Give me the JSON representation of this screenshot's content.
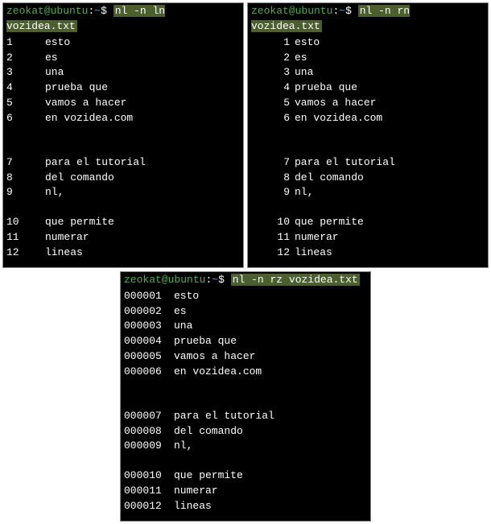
{
  "prompt": {
    "user": "zeokat",
    "host": "ubuntu",
    "path": "~",
    "symbol": "$"
  },
  "terminals": {
    "ln": {
      "command": "nl -n ln vozidea.txt",
      "lines": [
        {
          "n": "1",
          "t": "esto"
        },
        {
          "n": "2",
          "t": "es"
        },
        {
          "n": "3",
          "t": "una"
        },
        {
          "n": "4",
          "t": "prueba que"
        },
        {
          "n": "5",
          "t": "vamos a hacer"
        },
        {
          "n": "6",
          "t": "en vozidea.com"
        },
        {
          "blank": true
        },
        {
          "blank": true
        },
        {
          "n": "7",
          "t": "para el tutorial"
        },
        {
          "n": "8",
          "t": "del comando"
        },
        {
          "n": "9",
          "t": "nl,"
        },
        {
          "blank": true
        },
        {
          "n": "10",
          "t": "que permite"
        },
        {
          "n": "11",
          "t": "numerar"
        },
        {
          "n": "12",
          "t": "lineas"
        }
      ]
    },
    "rn": {
      "command": "nl -n rn vozidea.txt",
      "lines": [
        {
          "n": "1",
          "t": "esto"
        },
        {
          "n": "2",
          "t": "es"
        },
        {
          "n": "3",
          "t": "una"
        },
        {
          "n": "4",
          "t": "prueba que"
        },
        {
          "n": "5",
          "t": "vamos a hacer"
        },
        {
          "n": "6",
          "t": "en vozidea.com"
        },
        {
          "blank": true
        },
        {
          "blank": true
        },
        {
          "n": "7",
          "t": "para el tutorial"
        },
        {
          "n": "8",
          "t": "del comando"
        },
        {
          "n": "9",
          "t": "nl,"
        },
        {
          "blank": true
        },
        {
          "n": "10",
          "t": "que permite"
        },
        {
          "n": "11",
          "t": "numerar"
        },
        {
          "n": "12",
          "t": "lineas"
        }
      ]
    },
    "rz": {
      "command": "nl -n rz vozidea.txt",
      "lines": [
        {
          "n": "000001",
          "t": "esto"
        },
        {
          "n": "000002",
          "t": "es"
        },
        {
          "n": "000003",
          "t": "una"
        },
        {
          "n": "000004",
          "t": "prueba que"
        },
        {
          "n": "000005",
          "t": "vamos a hacer"
        },
        {
          "n": "000006",
          "t": "en vozidea.com"
        },
        {
          "blank": true
        },
        {
          "blank": true
        },
        {
          "n": "000007",
          "t": "para el tutorial"
        },
        {
          "n": "000008",
          "t": "del comando"
        },
        {
          "n": "000009",
          "t": "nl,"
        },
        {
          "blank": true
        },
        {
          "n": "000010",
          "t": "que permite"
        },
        {
          "n": "000011",
          "t": "numerar"
        },
        {
          "n": "000012",
          "t": "lineas"
        }
      ]
    }
  }
}
